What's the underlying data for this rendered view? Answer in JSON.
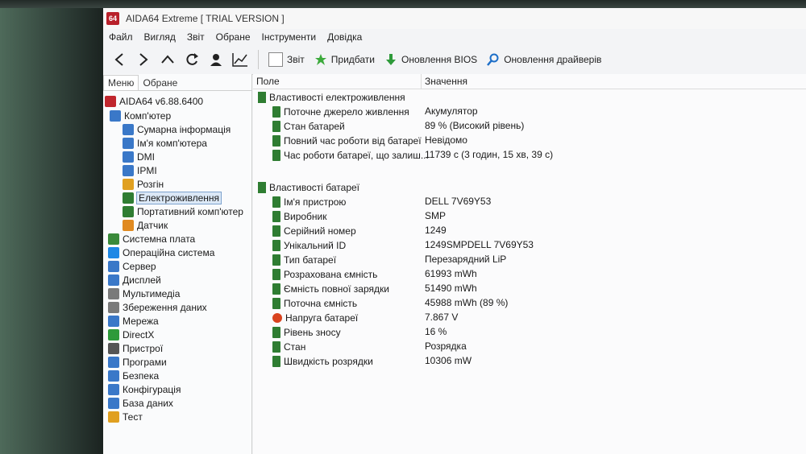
{
  "window": {
    "title": "AIDA64 Extreme  [ TRIAL VERSION ]",
    "icon_text": "64"
  },
  "menu": [
    "Файл",
    "Вигляд",
    "Звіт",
    "Обране",
    "Інструменти",
    "Довідка"
  ],
  "toolbar": {
    "report_label": "Звіт",
    "buy_label": "Придбати",
    "bios_update_label": "Оновлення BIOS",
    "driver_update_label": "Оновлення драйверів"
  },
  "left_pane": {
    "tabs": [
      "Меню",
      "Обране"
    ],
    "tree": [
      {
        "label": "AIDA64 v6.88.6400",
        "icon": "aida-icon",
        "color": "#c0262d"
      },
      {
        "label": "Комп'ютер",
        "icon": "computer-icon",
        "color": "#3a78c8"
      },
      {
        "label": "Сумарна інформація",
        "icon": "summary-icon",
        "color": "#3a78c8"
      },
      {
        "label": "Ім'я комп'ютера",
        "icon": "computer-name-icon",
        "color": "#3a78c8"
      },
      {
        "label": "DMI",
        "icon": "dmi-icon",
        "color": "#3a78c8"
      },
      {
        "label": "IPMI",
        "icon": "ipmi-icon",
        "color": "#3a78c8"
      },
      {
        "label": "Розгін",
        "icon": "overclock-icon",
        "color": "#e0a020"
      },
      {
        "label": "Електроживлення",
        "icon": "power-icon",
        "color": "#2f7d32"
      },
      {
        "label": "Портативний комп'ютер",
        "icon": "laptop-icon",
        "color": "#2f7d32"
      },
      {
        "label": "Датчик",
        "icon": "sensor-icon",
        "color": "#e08a20"
      },
      {
        "label": "Системна плата",
        "icon": "motherboard-icon",
        "color": "#3a8a3a"
      },
      {
        "label": "Операційна система",
        "icon": "windows-icon",
        "color": "#1e88e5"
      },
      {
        "label": "Сервер",
        "icon": "server-icon",
        "color": "#3a78c8"
      },
      {
        "label": "Дисплей",
        "icon": "display-icon",
        "color": "#3a78c8"
      },
      {
        "label": "Мультимедіа",
        "icon": "multimedia-icon",
        "color": "#7a7a7a"
      },
      {
        "label": "Збереження даних",
        "icon": "storage-icon",
        "color": "#7a7a7a"
      },
      {
        "label": "Мережа",
        "icon": "network-icon",
        "color": "#3a78c8"
      },
      {
        "label": "DirectX",
        "icon": "directx-icon",
        "color": "#2e9a3a"
      },
      {
        "label": "Пристрої",
        "icon": "devices-icon",
        "color": "#555555"
      },
      {
        "label": "Програми",
        "icon": "programs-icon",
        "color": "#3a78c8"
      },
      {
        "label": "Безпека",
        "icon": "security-icon",
        "color": "#3a78c8"
      },
      {
        "label": "Конфігурація",
        "icon": "config-icon",
        "color": "#3a78c8"
      },
      {
        "label": "База даних",
        "icon": "database-icon",
        "color": "#3a78c8"
      },
      {
        "label": "Тест",
        "icon": "test-icon",
        "color": "#e0a020"
      }
    ]
  },
  "columns": {
    "field": "Поле",
    "value": "Значення"
  },
  "power_group": {
    "title": "Властивості електроживлення",
    "rows": [
      {
        "field": "Поточне джерело живлення",
        "value": "Акумулятор"
      },
      {
        "field": "Стан батарей",
        "value": "89 % (Високий рівень)"
      },
      {
        "field": "Повний час роботи від батареї",
        "value": "Невідомо"
      },
      {
        "field": "Час роботи батареї, що залиш...",
        "value": "11739 с (3 годин, 15 хв, 39 с)"
      }
    ]
  },
  "battery_group": {
    "title": "Властивості батареї",
    "rows": [
      {
        "field": "Ім'я пристрою",
        "value": "DELL 7V69Y53"
      },
      {
        "field": "Виробник",
        "value": "SMP"
      },
      {
        "field": "Серійний номер",
        "value": "1249"
      },
      {
        "field": "Унікальний ID",
        "value": "1249SMPDELL 7V69Y53"
      },
      {
        "field": "Тип батареї",
        "value": "Перезарядний LiP"
      },
      {
        "field": "Розрахована ємність",
        "value": "61993 mWh"
      },
      {
        "field": "Ємність повної зарядки",
        "value": "51490 mWh"
      },
      {
        "field": "Поточна ємність",
        "value": "45988 mWh  (89 %)"
      },
      {
        "field": "Напруга батареї",
        "value": "7.867 V"
      },
      {
        "field": "Рівень зносу",
        "value": "16 %"
      },
      {
        "field": "Стан",
        "value": "Розрядка"
      },
      {
        "field": "Швидкість розрядки",
        "value": "10306 mW"
      }
    ]
  }
}
